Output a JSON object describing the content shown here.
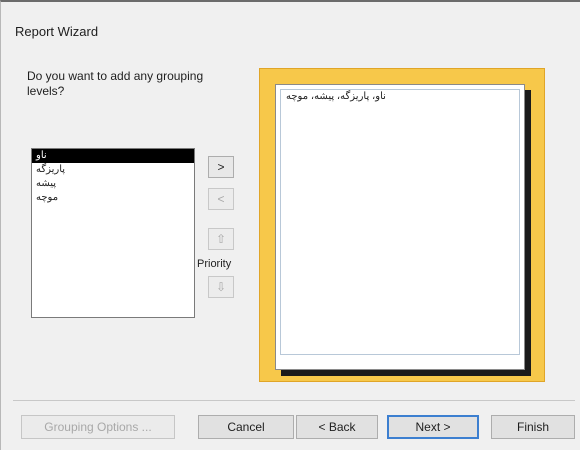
{
  "window": {
    "title": "Report Wizard"
  },
  "prompt": "Do you want to add any grouping levels?",
  "field_list": {
    "items": [
      {
        "label": "ناو",
        "selected": true
      },
      {
        "label": "پاریزگە",
        "selected": false
      },
      {
        "label": "پیشە",
        "selected": false
      },
      {
        "label": "موچە",
        "selected": false
      }
    ]
  },
  "controls": {
    "add_label": ">",
    "remove_label": "<",
    "priority_up_label": "⇧",
    "priority_down_label": "⇩",
    "priority_label": "Priority"
  },
  "preview": {
    "text": "ناو، پاریزگە، پیشە، موچە"
  },
  "buttons": {
    "grouping_options": "Grouping Options ...",
    "cancel": "Cancel",
    "back": "< Back",
    "next": "Next >",
    "finish": "Finish"
  },
  "colors": {
    "preview_frame": "#f7c84a",
    "default_button_border": "#3c7fd0"
  }
}
